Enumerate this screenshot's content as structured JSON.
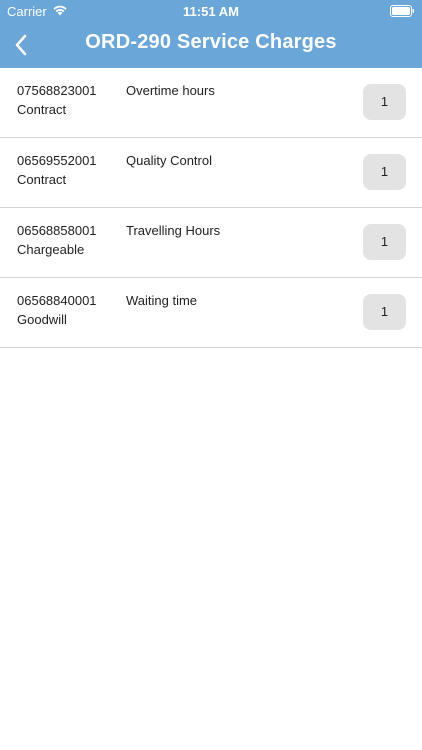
{
  "status_bar": {
    "carrier": "Carrier",
    "time": "11:51 AM"
  },
  "nav": {
    "title": "ORD-290 Service Charges",
    "back_icon": "chevron-left-icon"
  },
  "colors": {
    "header": "#6aa6d8",
    "qty_bg": "#e3e3e3",
    "divider": "#d4d4d4"
  },
  "charges": [
    {
      "code": "07568823001",
      "type": "Contract",
      "description": "Overtime hours",
      "qty": "1"
    },
    {
      "code": "06569552001",
      "type": "Contract",
      "description": "Quality Control",
      "qty": "1"
    },
    {
      "code": "06568858001",
      "type": "Chargeable",
      "description": "Travelling Hours",
      "qty": "1"
    },
    {
      "code": "06568840001",
      "type": "Goodwill",
      "description": "Waiting time",
      "qty": "1"
    }
  ]
}
